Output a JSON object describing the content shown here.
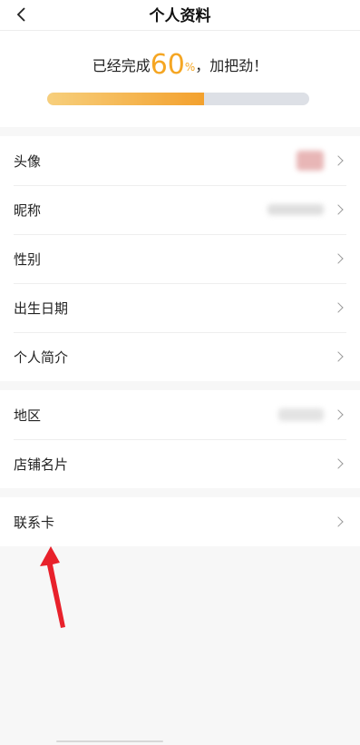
{
  "header": {
    "title": "个人资料"
  },
  "progress": {
    "prefix": "已经完成",
    "value": "60",
    "percent_sign": "%",
    "suffix": "，加把劲！",
    "fraction": 0.6
  },
  "groups": [
    {
      "items": [
        {
          "label": "头像"
        },
        {
          "label": "昵称"
        },
        {
          "label": "性别"
        },
        {
          "label": "出生日期"
        },
        {
          "label": "个人简介"
        }
      ]
    },
    {
      "items": [
        {
          "label": "地区"
        },
        {
          "label": "店铺名片"
        }
      ]
    },
    {
      "items": [
        {
          "label": "联系卡"
        }
      ]
    }
  ],
  "colors": {
    "accent": "#f5a623",
    "bar_track": "#dde0e6",
    "annotation_arrow": "#e8212b"
  },
  "icons": {
    "back": "chevron-left-icon",
    "row_arrow": "chevron-right-icon"
  }
}
